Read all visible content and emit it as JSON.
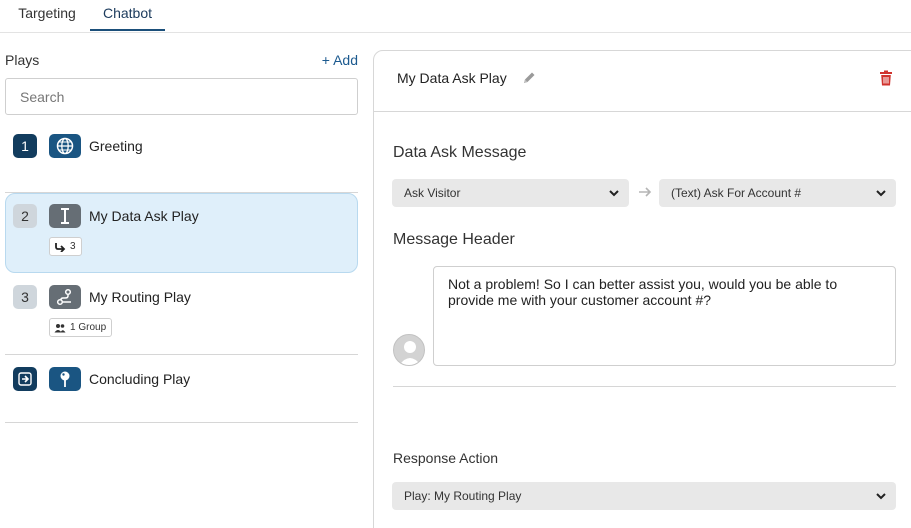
{
  "tabs": [
    {
      "label": "Targeting",
      "active": false
    },
    {
      "label": "Chatbot",
      "active": true
    }
  ],
  "plays_panel": {
    "title": "Plays",
    "add_label": "+ Add",
    "search_placeholder": "Search",
    "items": [
      {
        "number": "1",
        "icon": "globe-icon",
        "label": "Greeting",
        "chip": null
      },
      {
        "number": "2",
        "icon": "text-cursor-icon",
        "label": "My Data Ask Play",
        "chip": "3",
        "chip_icon": "redirect-arrow-icon",
        "selected": true
      },
      {
        "number": "3",
        "icon": "route-icon",
        "label": "My Routing Play",
        "chip": "1 Group",
        "chip_icon": "users-icon"
      },
      {
        "number": "",
        "number_icon": "exit-icon",
        "icon": "pin-icon",
        "label": "Concluding Play",
        "chip": null
      }
    ]
  },
  "detail": {
    "play_name": "My Data Ask Play",
    "section_data_ask": "Data Ask Message",
    "ask_select": "Ask Visitor",
    "ask_type_select": "(Text) Ask For Account #",
    "section_header": "Message Header",
    "message_text": "Not a problem! So I can better assist you, would you be able to provide me with your customer account #?",
    "response_label": "Response Action",
    "response_select": "Play: My Routing Play"
  },
  "colors": {
    "accent_dark": "#123c5e",
    "accent_blue": "#1a5582",
    "selected_bg": "#dfeffa",
    "delete_red": "#d0332e",
    "link": "#1c5a8f"
  }
}
